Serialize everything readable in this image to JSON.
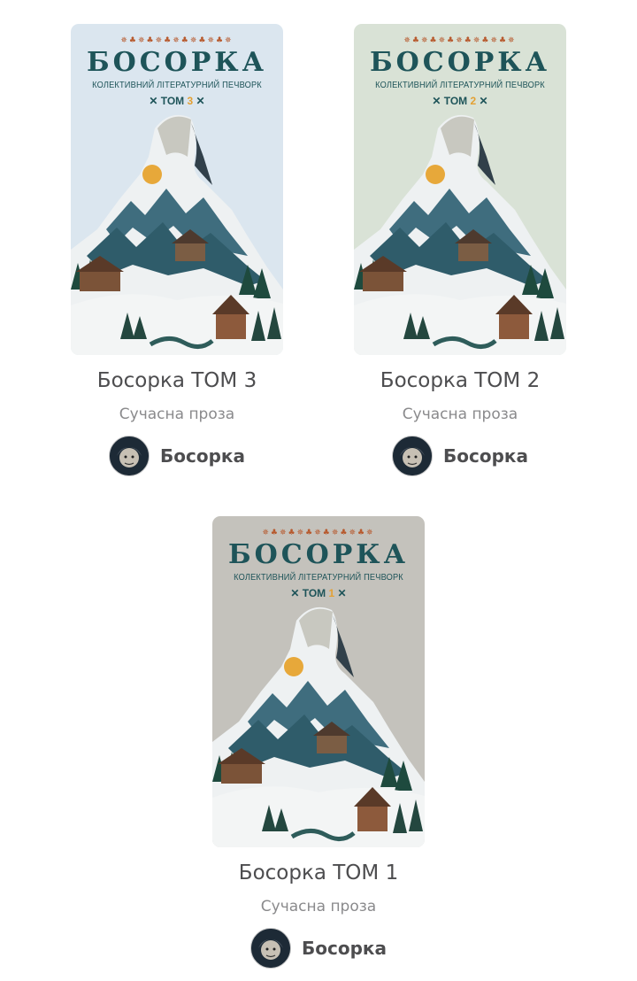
{
  "books": [
    {
      "cover": {
        "ornament": "✵♣✵♣✵♣✵♣✵♣✵♣✵",
        "title": "БОСОРКА",
        "subtitle": "КОЛЕКТИВНИЙ ЛІТЕРАТУРНИЙ ПЕЧВОРК",
        "volume_label": "ТОМ",
        "volume_number": "3",
        "bg_color": "#dbe6ef"
      },
      "title": "Босорка ТОМ 3",
      "genre": "Сучасна проза",
      "author": "Босорка"
    },
    {
      "cover": {
        "ornament": "✵♣✵♣✵♣✵♣✵♣✵♣✵",
        "title": "БОСОРКА",
        "subtitle": "КОЛЕКТИВНИЙ ЛІТЕРАТУРНИЙ ПЕЧВОРК",
        "volume_label": "ТОМ",
        "volume_number": "2",
        "bg_color": "#d9e2d6"
      },
      "title": "Босорка ТОМ 2",
      "genre": "Сучасна проза",
      "author": "Босорка"
    },
    {
      "cover": {
        "ornament": "✵♣✵♣✵♣✵♣✵♣✵♣✵",
        "title": "БОСОРКА",
        "subtitle": "КОЛЕКТИВНИЙ ЛІТЕРАТУРНИЙ ПЕЧВОРК",
        "volume_label": "ТОМ",
        "volume_number": "1",
        "bg_color": "#c4c2bc"
      },
      "title": "Босорка ТОМ 1",
      "genre": "Сучасна проза",
      "author": "Босорка"
    }
  ]
}
